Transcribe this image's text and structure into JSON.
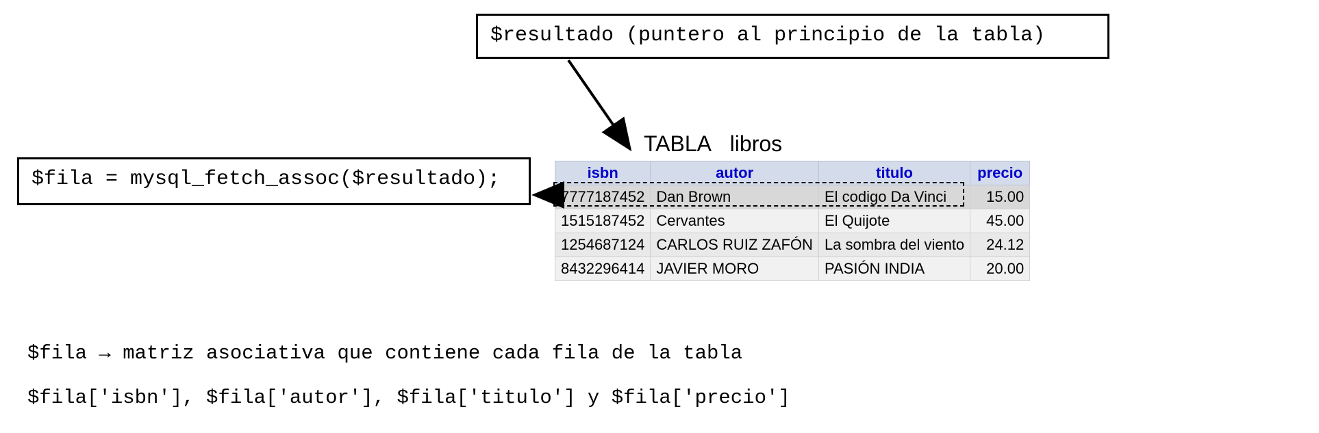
{
  "top_box": "$resultado (puntero al principio de la tabla)",
  "left_box": "$fila = mysql_fetch_assoc($resultado);",
  "table": {
    "title": "TABLA   libros",
    "headers": [
      "isbn",
      "autor",
      "titulo",
      "precio"
    ],
    "rows": [
      {
        "isbn": "7777187452",
        "autor": "Dan Brown",
        "titulo": "El codigo Da Vinci",
        "precio": "15.00",
        "sel": true
      },
      {
        "isbn": "1515187452",
        "autor": "Cervantes",
        "titulo": "El Quijote",
        "precio": "45.00",
        "sel": false
      },
      {
        "isbn": "1254687124",
        "autor": "CARLOS RUIZ ZAFÓN",
        "titulo": "La sombra del viento",
        "precio": "24.12",
        "sel": false
      },
      {
        "isbn": "8432296414",
        "autor": "JAVIER MORO",
        "titulo": "PASIÓN INDIA",
        "precio": "20.00",
        "sel": false
      }
    ]
  },
  "explain_line1_prefix": "$fila ",
  "explain_arrow": "→",
  "explain_line1_suffix": " matriz asociativa que contiene cada fila de la tabla",
  "explain_line2": "$fila['isbn'], $fila['autor'], $fila['titulo'] y $fila['precio']"
}
